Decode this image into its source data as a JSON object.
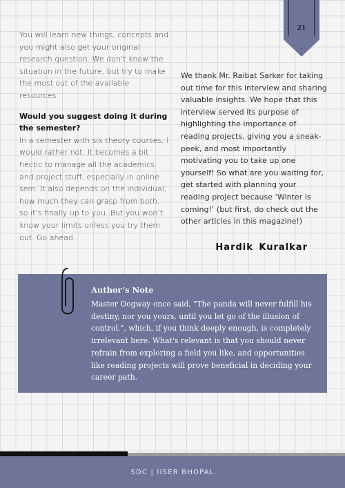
{
  "page_number": "21",
  "left_column": {
    "intro": "You will learn new things, concepts and you might also get your original research question. We don’t know the situation in the future, but try to make the most out of the available resources.",
    "question": "Would you suggest doing it during the semester?",
    "answer": "In a semester with six theory courses, I would rather not. It becomes a bit hectic to manage all the academics and project stuff, especially in online sem. It also depends on the individual, how much they can grasp from both, so it’s finally up to you. But you won’t know your limits unless you try them out. Go ahead."
  },
  "right_column": {
    "closing": "We thank Mr. Raibat Sarker for taking out time for this interview and sharing valuable insights. We hope that this interview served its purpose of highlighting the importance of reading projects, giving you a sneak-peek, and most importantly motivating you to take up one yourself! So what are you waiting for, get started with planning your reading project because ‘Winter is coming!’ (but first, do check out the other articles in this magazine!)"
  },
  "author_name": "Hardik  Kuralkar",
  "authors_note": {
    "title": "Author’s Note",
    "text": "Master Oogway once said, \"The panda will never fulfill his destiny, nor you yours, until you let go of the illusion of control.\", which, if you think deeply enough, is completely irrelevant here. What's relevant is that you should never refrain from exploring a field you like, and opportunities like reading projects will prove beneficial in deciding your career path."
  },
  "footer": "SDC | IISER BHOPAL",
  "colors": {
    "accent": "#6e7599",
    "accent_dark": "#3d4263",
    "text": "#333333",
    "background": "#f4f4f4"
  },
  "icons": {
    "clip": "paperclip-icon"
  }
}
